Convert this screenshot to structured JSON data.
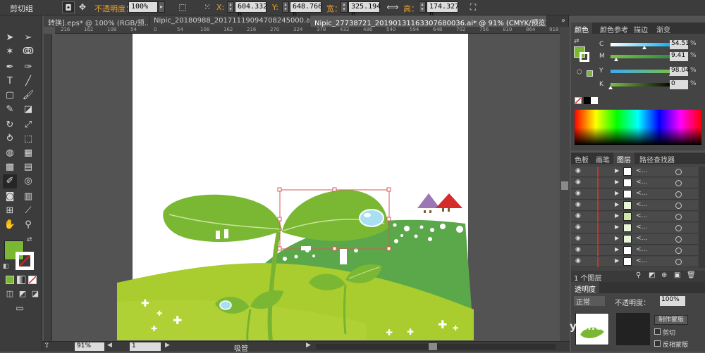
{
  "control_bar": {
    "group_label": "剪切组",
    "opacity_label": "不透明度：",
    "opacity_value": "100%",
    "x_label": "X:",
    "x_value": "604.332 p",
    "y_label": "Y:",
    "y_value": "648.766 p",
    "w_label": "宽：",
    "w_value": "325.194 p",
    "h_label": "高：",
    "h_value": "174.327 p"
  },
  "tabs": [
    {
      "label": "转换].eps* @ 100% (RGB/预..."
    },
    {
      "label": "Nipic_20180988_20171119094708245000.ai*"
    },
    {
      "label": "Nipic_27738721_20190131163307680036.ai* @ 91% (CMYK/预览)"
    }
  ],
  "ruler": {
    "ticks": [
      "216",
      "162",
      "108",
      "54",
      "0",
      "54",
      "108",
      "162",
      "216",
      "270",
      "324",
      "378",
      "432",
      "486",
      "540",
      "594",
      "648",
      "702",
      "756",
      "810",
      "864",
      "918"
    ]
  },
  "status": {
    "zoom": "91%",
    "page": "1",
    "tool_name": "吸管"
  },
  "color_panel": {
    "tabs": [
      "颜色",
      "颜色参考",
      "描边",
      "渐变"
    ],
    "channels": [
      {
        "ch": "C",
        "value": "54.51",
        "pct": 0.5451,
        "gradient": "linear-gradient(to right,#ffffff,#00aeef)"
      },
      {
        "ch": "M",
        "value": "9.41",
        "pct": 0.0941,
        "gradient": "linear-gradient(to right,#7ac143,#2a8a43)"
      },
      {
        "ch": "Y",
        "value": "98.04",
        "pct": 0.9804,
        "gradient": "linear-gradient(to right,#3fa9f5,#7ac143)"
      },
      {
        "ch": "K",
        "value": "0",
        "pct": 0.0,
        "gradient": "linear-gradient(to right,#7cc242,#000000)"
      }
    ],
    "percent_sign": "%",
    "fill_color": "#7ab833"
  },
  "layers_panel": {
    "tabs": [
      "色板",
      "画笔",
      "图层",
      "路径查找器"
    ],
    "row_label": "<...",
    "rows": 9,
    "footer_label": "1 个图层"
  },
  "transparency_panel": {
    "tab": "透明度",
    "mode": "正常",
    "opacity_label": "不透明度：",
    "opacity_value": "100%",
    "make_mask": "制作蒙版",
    "clip_label": "剪切",
    "invert_label": "反相蒙版"
  },
  "watermark": "yan.c"
}
